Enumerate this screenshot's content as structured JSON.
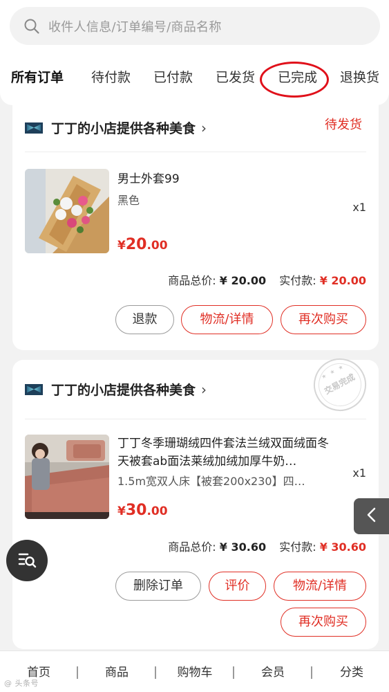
{
  "search": {
    "placeholder": "收件人信息/订单编号/商品名称"
  },
  "tabs": [
    {
      "label": "所有订单"
    },
    {
      "label": "待付款"
    },
    {
      "label": "已付款"
    },
    {
      "label": "已发货"
    },
    {
      "label": "已完成"
    },
    {
      "label": "退换货"
    }
  ],
  "orders": [
    {
      "shop_name": "丁丁的小店提供各种美食",
      "status": "待发货",
      "product": {
        "title": "男士外套99",
        "spec": "黑色",
        "qty": "x1",
        "price_yen": "¥",
        "price_int": "20",
        "price_dec": ".00"
      },
      "summary": {
        "total_label": "商品总价:",
        "total_value": "¥ 20.00",
        "paid_label": "实付款:",
        "paid_value": "¥ 20.00"
      },
      "buttons": [
        "退款",
        "物流/详情",
        "再次购买"
      ]
    },
    {
      "shop_name": "丁丁的小店提供各种美食",
      "stamp_text": "交易完成",
      "stamp_stars": "★ ★ ★",
      "product": {
        "title": "丁丁冬季珊瑚绒四件套法兰绒双面绒面冬天被套ab面法莱绒加绒加厚牛奶…",
        "spec": "1.5m宽双人床【被套200x230】四…",
        "qty": "x1",
        "price_yen": "¥",
        "price_int": "30",
        "price_dec": ".00"
      },
      "summary": {
        "total_label": "商品总价:",
        "total_value": "¥ 30.60",
        "paid_label": "实付款:",
        "paid_value": "¥ 30.60"
      },
      "buttons": [
        "删除订单",
        "评价",
        "物流/详情",
        "再次购买"
      ]
    }
  ],
  "bottom_nav": [
    {
      "label": "首页"
    },
    {
      "label": "商品"
    },
    {
      "label": "购物车"
    },
    {
      "label": "会员"
    },
    {
      "label": "分类"
    }
  ],
  "watermark": "@ 头条号"
}
